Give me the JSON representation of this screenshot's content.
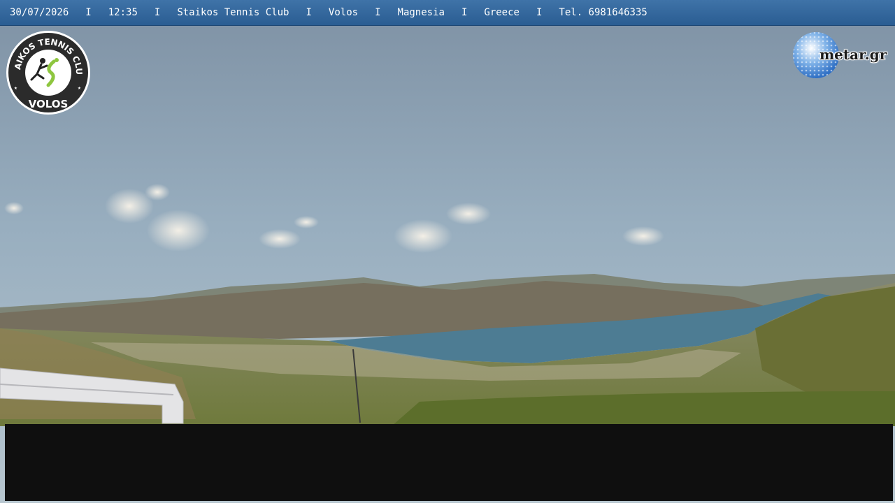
{
  "header": {
    "date": "30/07/2026",
    "time": "12:35",
    "club": "Staikos Tennis Club",
    "city": "Volos",
    "region": "Magnesia",
    "country": "Greece",
    "phone": "Tel. 6981646335",
    "separator": "I"
  },
  "logos": {
    "club_logo": {
      "top_text": "STAIKOS TENNIS CLUB",
      "bottom_text": "VOLOS",
      "icon": "tennis-player-icon"
    },
    "provider_logo": {
      "text": "metar.gr",
      "icon": "golf-ball-globe-icon"
    }
  },
  "colors": {
    "header_bar": "#2f639a",
    "sky_top": "#8496a8",
    "sea": "#4d7c93",
    "panel": "#0f0f0f"
  }
}
